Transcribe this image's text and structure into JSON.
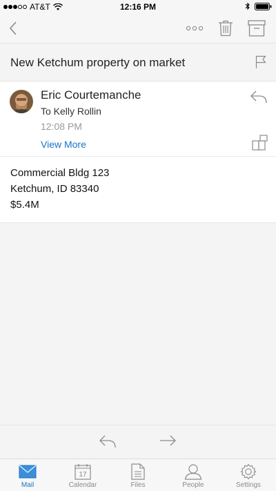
{
  "status_bar": {
    "carrier": "AT&T",
    "time": "12:16 PM"
  },
  "toolbar": {
    "back_icon": "chevron-left-icon",
    "more_icon": "more-icon",
    "delete_icon": "trash-icon",
    "archive_icon": "archive-icon"
  },
  "message": {
    "subject": "New Ketchum property on market",
    "sender": "Eric Courtemanche",
    "recipient": "To Kelly Rollin",
    "time": "12:08 PM",
    "view_more": "View More",
    "body_lines": [
      "Commercial Bldg 123",
      "Ketchum, ID 83340",
      "$5.4M"
    ]
  },
  "tabs": [
    {
      "label": "Mail",
      "icon": "mail-icon",
      "active": true
    },
    {
      "label": "Calendar",
      "icon": "calendar-icon",
      "active": false,
      "day": "17"
    },
    {
      "label": "Files",
      "icon": "files-icon",
      "active": false
    },
    {
      "label": "People",
      "icon": "people-icon",
      "active": false
    },
    {
      "label": "Settings",
      "icon": "settings-icon",
      "active": false
    }
  ],
  "colors": {
    "accent": "#1a73c9",
    "icon_gray": "#8a8a8a"
  }
}
